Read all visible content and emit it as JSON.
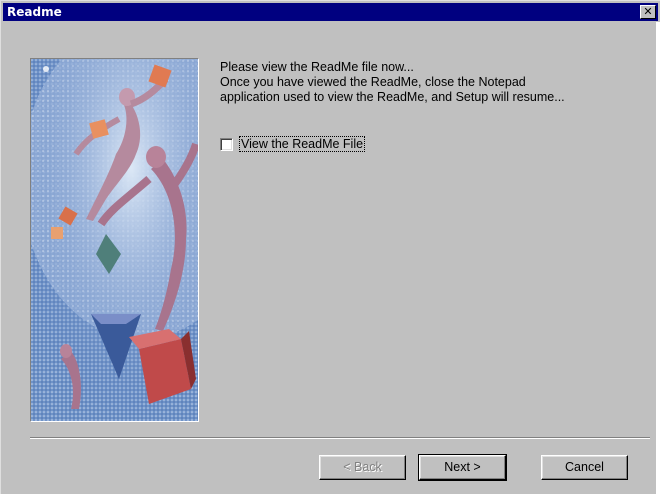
{
  "window": {
    "title": "Readme",
    "close_glyph": "✕"
  },
  "message": {
    "lines": [
      "Please view the ReadMe file now...",
      "Once you have viewed the ReadMe, close the Notepad",
      "application used to view the ReadMe, and Setup will resume..."
    ]
  },
  "checkbox": {
    "label": "View the ReadMe File",
    "checked": false
  },
  "buttons": {
    "back": "< Back",
    "next": "Next >",
    "cancel": "Cancel"
  },
  "colors": {
    "titlebar": "#000080",
    "face": "#c0c0c0",
    "shadow": "#808080",
    "highlight": "#ffffff"
  },
  "illustration": {
    "icon": "setup-artwork-dancing-figures"
  }
}
